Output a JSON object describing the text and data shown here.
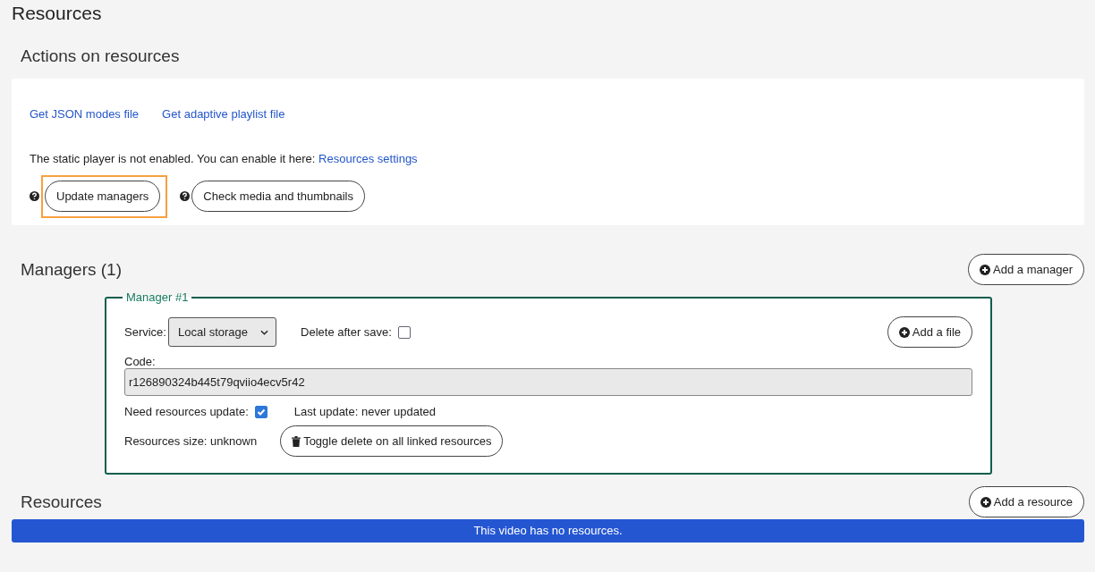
{
  "page_title": "Resources",
  "actions": {
    "heading": "Actions on resources",
    "links": [
      "Get JSON modes file",
      "Get adaptive playlist file"
    ],
    "notice": "The static player is not enabled. You can enable it here:",
    "notice_link": "Resources settings",
    "buttons": [
      {
        "label": "Update managers",
        "highlighted": true
      },
      {
        "label": "Check media and thumbnails",
        "highlighted": false
      }
    ]
  },
  "managers": {
    "heading": "Managers (1)",
    "add_button": "Add a manager",
    "items": [
      {
        "legend": "Manager #1",
        "add_file": "Add a file",
        "service_label": "Service:",
        "service_value": "Local storage",
        "delete_label": "Delete after save:",
        "delete_checked": false,
        "code_label": "Code:",
        "code_value": "r126890324b445t79qviio4ecv5r42",
        "update_label": "Need resources update:",
        "update_checked": true,
        "last_update": "Last update: never updated",
        "size": "Resources size: unknown",
        "toggle_button": "Toggle delete on all linked resources"
      }
    ]
  },
  "resources": {
    "heading": "Resources",
    "add_button": "Add a resource",
    "empty_message": "This video has no resources."
  }
}
